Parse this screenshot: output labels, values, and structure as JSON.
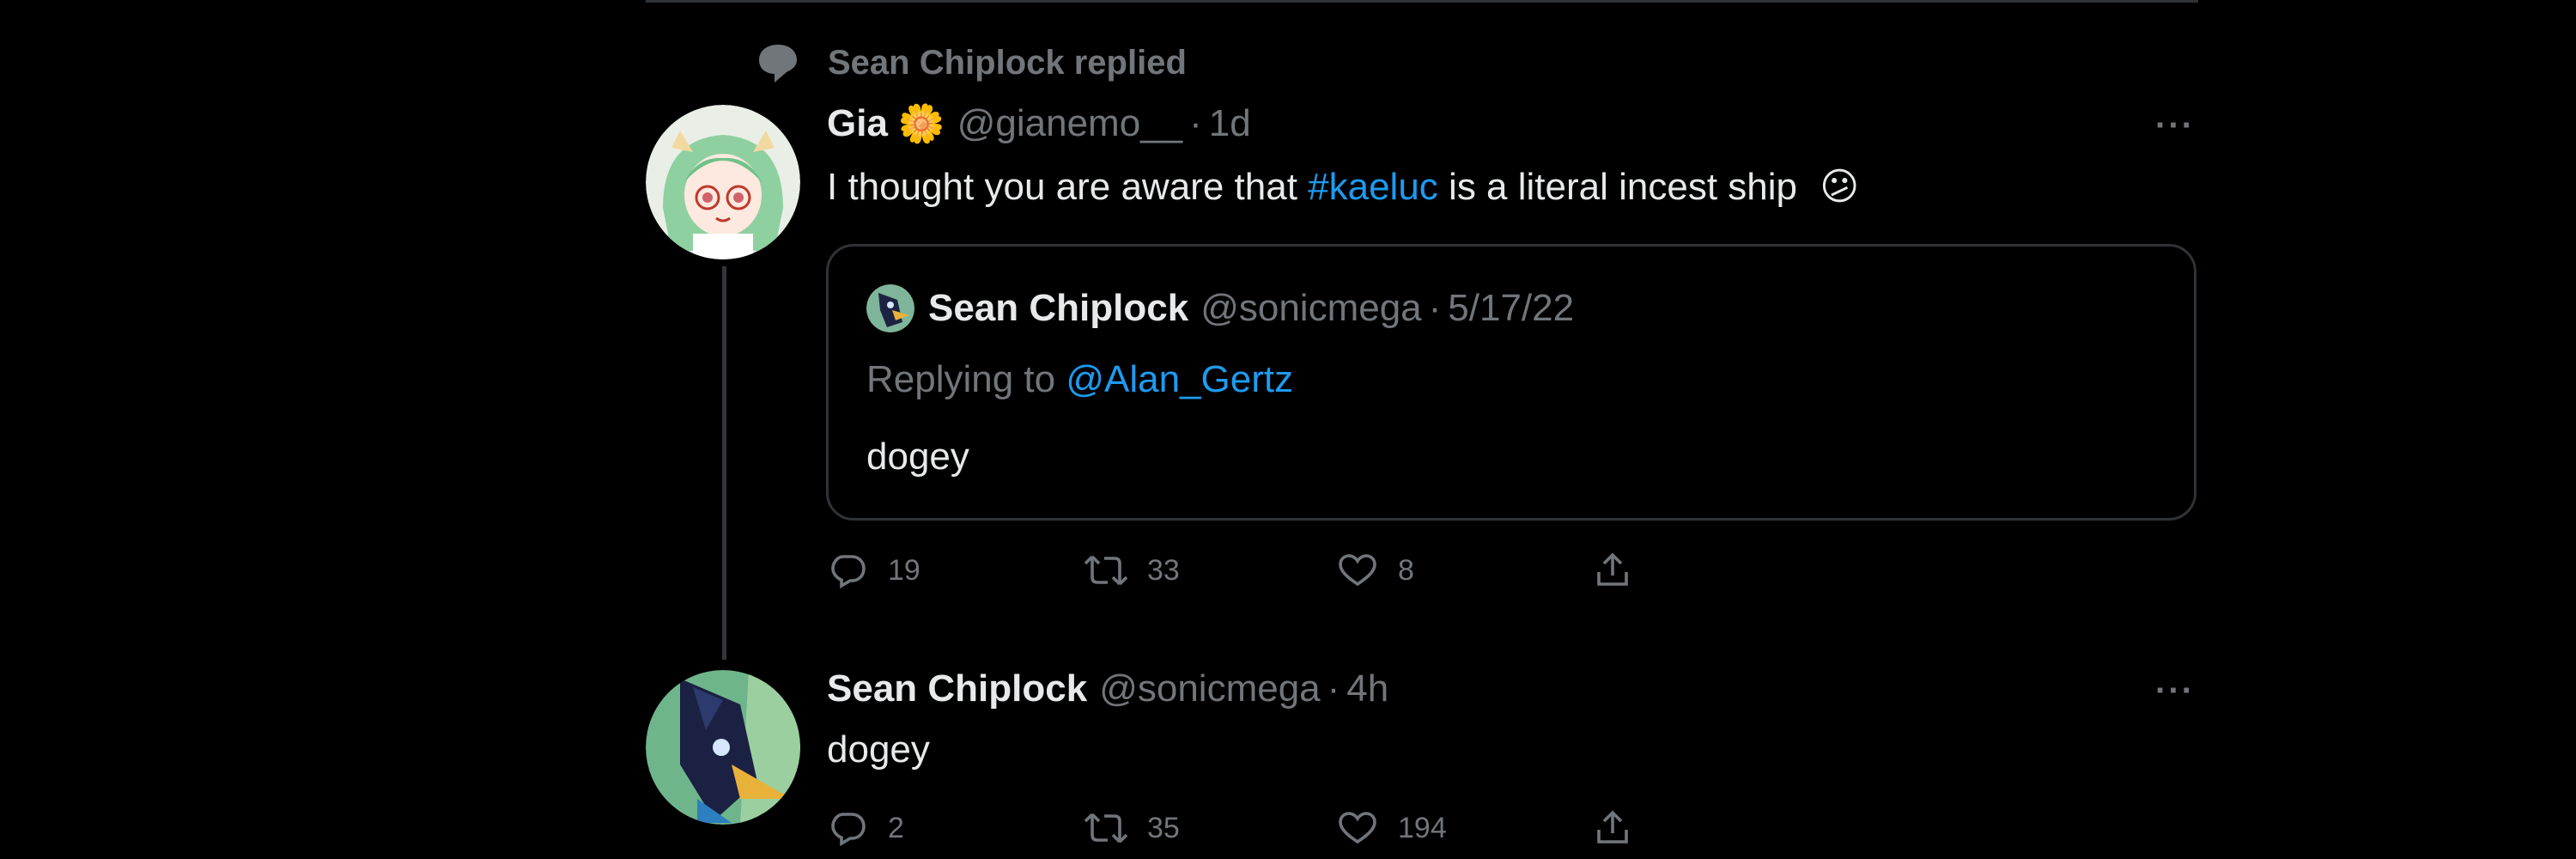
{
  "context": {
    "text": "Sean Chiplock replied"
  },
  "reply": {
    "name": "Gia",
    "emoji": "🌼",
    "handle": "@gianemo__",
    "dot": "·",
    "time": "1d",
    "more": "···",
    "text_before": "I thought you are aware that ",
    "hashtag": "#kaeluc",
    "text_after": " is a literal incest ship",
    "text_emoji": "😕",
    "quote": {
      "name": "Sean Chiplock",
      "handle": "@sonicmega",
      "dot": "·",
      "date": "5/17/22",
      "replying_prefix": "Replying to ",
      "replying_handle": "@Alan_Gertz",
      "text": "dogey"
    },
    "actions": {
      "replies": "19",
      "retweets": "33",
      "likes": "8"
    }
  },
  "main": {
    "name": "Sean Chiplock",
    "handle": "@sonicmega",
    "dot": "·",
    "time": "4h",
    "more": "···",
    "text": "dogey",
    "actions": {
      "replies": "2",
      "retweets": "35",
      "likes": "194"
    }
  },
  "colors": {
    "background": "#000000",
    "link": "#1d9bf0",
    "muted": "#71767b",
    "text": "#e7e9ea"
  }
}
